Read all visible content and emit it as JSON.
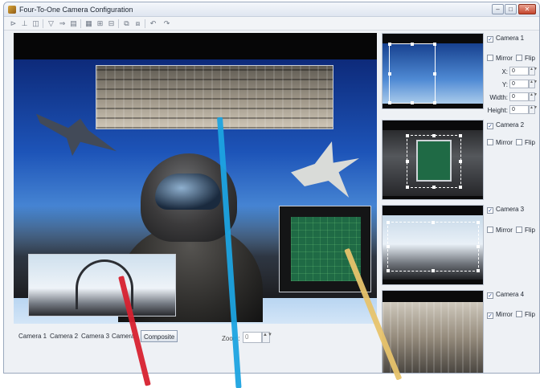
{
  "window": {
    "title": "Four-To-One Camera Configuration",
    "controls": {
      "minimize": "–",
      "maximize": "□",
      "close": "✕"
    }
  },
  "toolbar": {
    "icons": [
      "step-back-icon",
      "step-icon",
      "save-icon",
      "filter-icon",
      "forward-icon",
      "print-icon",
      "grid-icon",
      "layout-icon",
      "layout-split-icon",
      "copy-icon",
      "paste-icon",
      "undo-icon",
      "redo-icon"
    ],
    "glyphs": [
      "⊳",
      "⊥",
      "◫",
      "▽",
      "⇒",
      "▤",
      "▦",
      "⊞",
      "⊟",
      "⧉",
      "⧈",
      "↶",
      "↷"
    ]
  },
  "view_tabs": [
    {
      "label": "Camera 1",
      "active": false
    },
    {
      "label": "Camera 2",
      "active": false
    },
    {
      "label": "Camera 3",
      "active": false
    },
    {
      "label": "Camera",
      "active": false
    },
    {
      "label": "Composite",
      "active": true
    }
  ],
  "zoom": {
    "label": "Zoom:",
    "value": "0"
  },
  "cameras": [
    {
      "label": "Camera 1",
      "enabled": true,
      "mirror_label": "Mirror",
      "mirror": false,
      "flip_label": "Flip",
      "flip": false,
      "fields": [
        {
          "label": "X:",
          "value": "0"
        },
        {
          "label": "Y:",
          "value": "0"
        },
        {
          "label": "Width:",
          "value": "0"
        },
        {
          "label": "Height:",
          "value": "0"
        }
      ]
    },
    {
      "label": "Camera 2",
      "enabled": true,
      "mirror_label": "Mirror",
      "mirror": false,
      "flip_label": "Flip",
      "flip": false
    },
    {
      "label": "Camera 3",
      "enabled": true,
      "mirror_label": "Mirror",
      "mirror": false,
      "flip_label": "Flip",
      "flip": false
    },
    {
      "label": "Camera 4",
      "enabled": true,
      "mirror_label": "Mirror",
      "mirror": true,
      "flip_label": "Flip",
      "flip": false
    }
  ],
  "check_glyph": "✓",
  "spin_glyph": "▲▼"
}
